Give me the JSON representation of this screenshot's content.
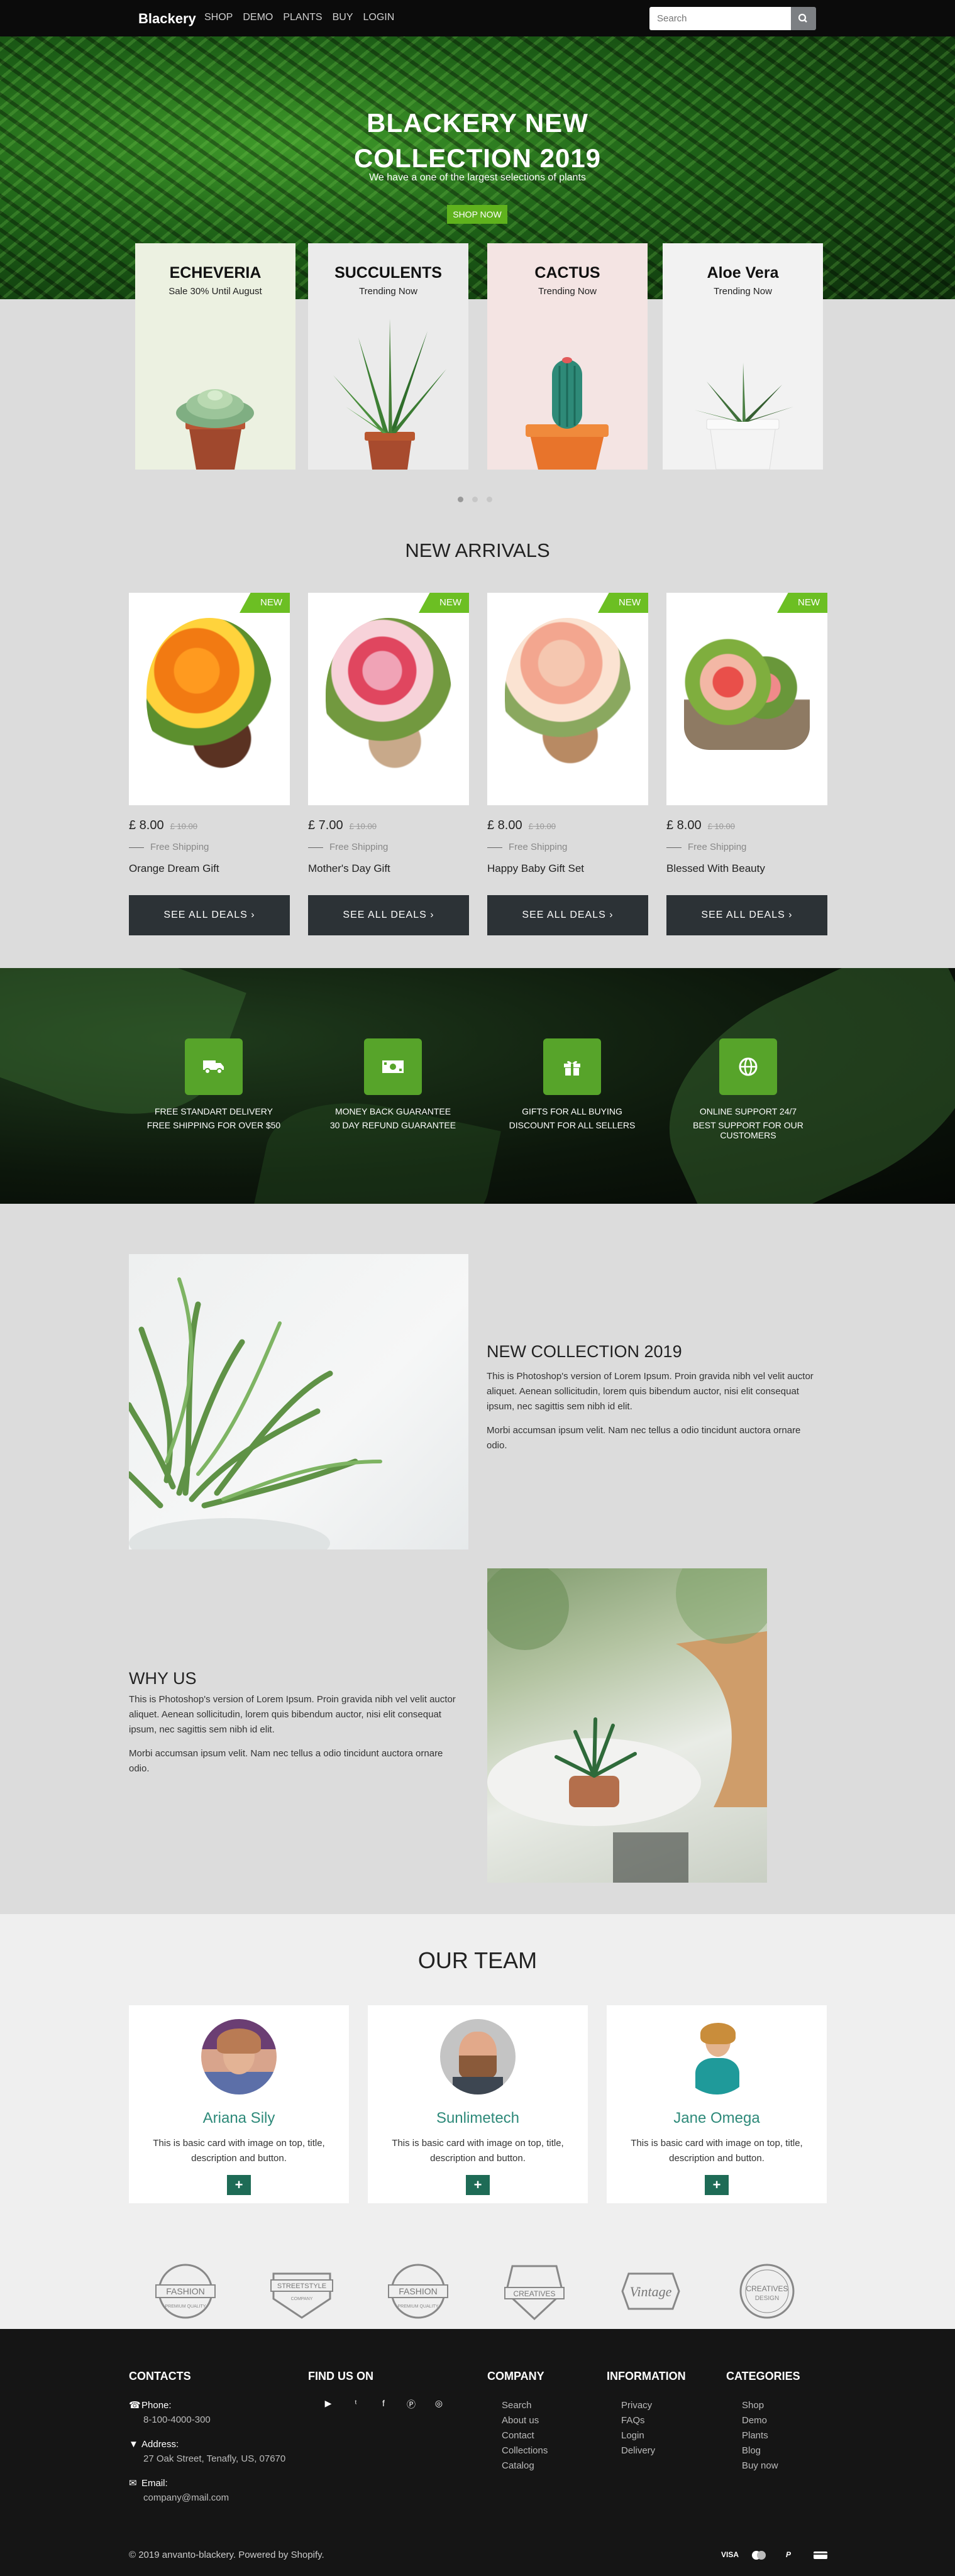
{
  "nav": {
    "brand": "Blackery",
    "items": [
      "SHOP",
      "DEMO",
      "PLANTS",
      "BUY",
      "LOGIN"
    ],
    "search_placeholder": "Search",
    "search_icon": "search-icon"
  },
  "hero": {
    "title_line1": "BLACKERY NEW",
    "title_line2": "COLLECTION 2019",
    "subtitle": "We have a one of the largest selections of plants",
    "button": "SHOP NOW"
  },
  "collections": [
    {
      "title": "ECHEVERIA",
      "subtitle": "Sale 30% Until August",
      "bg": "#ecf1e1"
    },
    {
      "title": "SUCCULENTS",
      "subtitle": "Trending Now",
      "bg": "#ebebeb"
    },
    {
      "title": "CACTUS",
      "subtitle": "Trending Now",
      "bg": "#f4e4e3"
    },
    {
      "title": "Aloe Vera",
      "subtitle": "Trending Now",
      "bg": "#f2f2f2"
    }
  ],
  "arrivals": {
    "title": "NEW ARRIVALS",
    "badge": "NEW",
    "shipping": "Free Shipping",
    "deal_button": "SEE ALL DEALS",
    "products": [
      {
        "name": "Orange Dream Gift",
        "price": "£ 8.00",
        "old_price": "£ 10.00"
      },
      {
        "name": "Mother's Day Gift",
        "price": "£ 7.00",
        "old_price": "£ 10.00"
      },
      {
        "name": "Happy Baby Gift Set",
        "price": "£ 8.00",
        "old_price": "£ 10.00"
      },
      {
        "name": "Blessed With Beauty",
        "price": "£ 8.00",
        "old_price": "£ 10.00"
      }
    ]
  },
  "features": [
    {
      "icon": "truck-icon",
      "line1": "FREE STANDART DELIVERY",
      "line2": "FREE SHIPPING FOR OVER $50"
    },
    {
      "icon": "money-icon",
      "line1": "MONEY BACK GUARANTEE",
      "line2": "30 DAY REFUND GUARANTEE"
    },
    {
      "icon": "gift-icon",
      "line1": "GIFTS FOR ALL BUYING",
      "line2": "DISCOUNT FOR ALL SELLERS"
    },
    {
      "icon": "globe-icon",
      "line1": "ONLINE SUPPORT 24/7",
      "line2": "BEST SUPPORT FOR OUR CUSTOMERS"
    }
  ],
  "about": {
    "collection_title": "NEW COLLECTION 2019",
    "collection_p1": "This is Photoshop's version of Lorem Ipsum. Proin gravida nibh vel velit auctor aliquet. Aenean sollicitudin, lorem quis bibendum auctor, nisi elit consequat ipsum, nec sagittis sem nibh id elit.",
    "collection_p2": "Morbi accumsan ipsum velit. Nam nec tellus a odio tincidunt auctora ornare odio.",
    "why_title": "WHY US",
    "why_p1": "This is Photoshop's version of Lorem Ipsum. Proin gravida nibh vel velit auctor aliquet. Aenean sollicitudin, lorem quis bibendum auctor, nisi elit consequat ipsum, nec sagittis sem nibh id elit.",
    "why_p2": "Morbi accumsan ipsum velit. Nam nec tellus a odio tincidunt auctora ornare odio."
  },
  "team": {
    "title": "OUR TEAM",
    "members": [
      {
        "name": "Ariana Sily",
        "desc": "This is basic card with image on top, title, description and button.",
        "button": "+"
      },
      {
        "name": "Sunlimetech",
        "desc": "This is basic card with image on top, title, description and button.",
        "button": "+"
      },
      {
        "name": "Jane Omega",
        "desc": "This is basic card with image on top, title, description and button.",
        "button": "+"
      }
    ]
  },
  "brands": [
    {
      "top": "",
      "main": "FASHION",
      "bottom": "PREMIUM QUALITY"
    },
    {
      "top": "",
      "main": "STREETSTYLE",
      "bottom": "COMPANY"
    },
    {
      "top": "",
      "main": "FASHION",
      "bottom": "PREMIUM QUALITY"
    },
    {
      "top": "",
      "main": "CREATIVES",
      "bottom": ""
    },
    {
      "top": "",
      "main": "Vintage",
      "bottom": ""
    },
    {
      "top": "",
      "main": "CREATIVES",
      "bottom": "DESIGN"
    }
  ],
  "footer": {
    "contacts_title": "CONTACTS",
    "phone_label": "Phone:",
    "phone": "8-100-4000-300",
    "address_label": "Address:",
    "address": "27 Oak Street, Tenafly, US, 07670",
    "email_label": "Email:",
    "email": "company@mail.com",
    "findus_title": "FIND US ON",
    "social": [
      "youtube-icon",
      "twitter-icon",
      "facebook-icon",
      "pinterest-icon",
      "instagram-icon"
    ],
    "company_title": "COMPANY",
    "company_links": [
      "Search",
      "About us",
      "Contact",
      "Collections",
      "Catalog"
    ],
    "info_title": "INFORMATION",
    "info_links": [
      "Privacy",
      "FAQs",
      "Login",
      "Delivery"
    ],
    "cat_title": "CATEGORIES",
    "cat_links": [
      "Shop",
      "Demo",
      "Plants",
      "Blog",
      "Buy now"
    ],
    "copyright": "© 2019 anvanto-blackery. Powered by Shopify.",
    "payments": [
      "VISA",
      "mastercard-icon",
      "paypal-icon",
      "card-icon"
    ]
  }
}
